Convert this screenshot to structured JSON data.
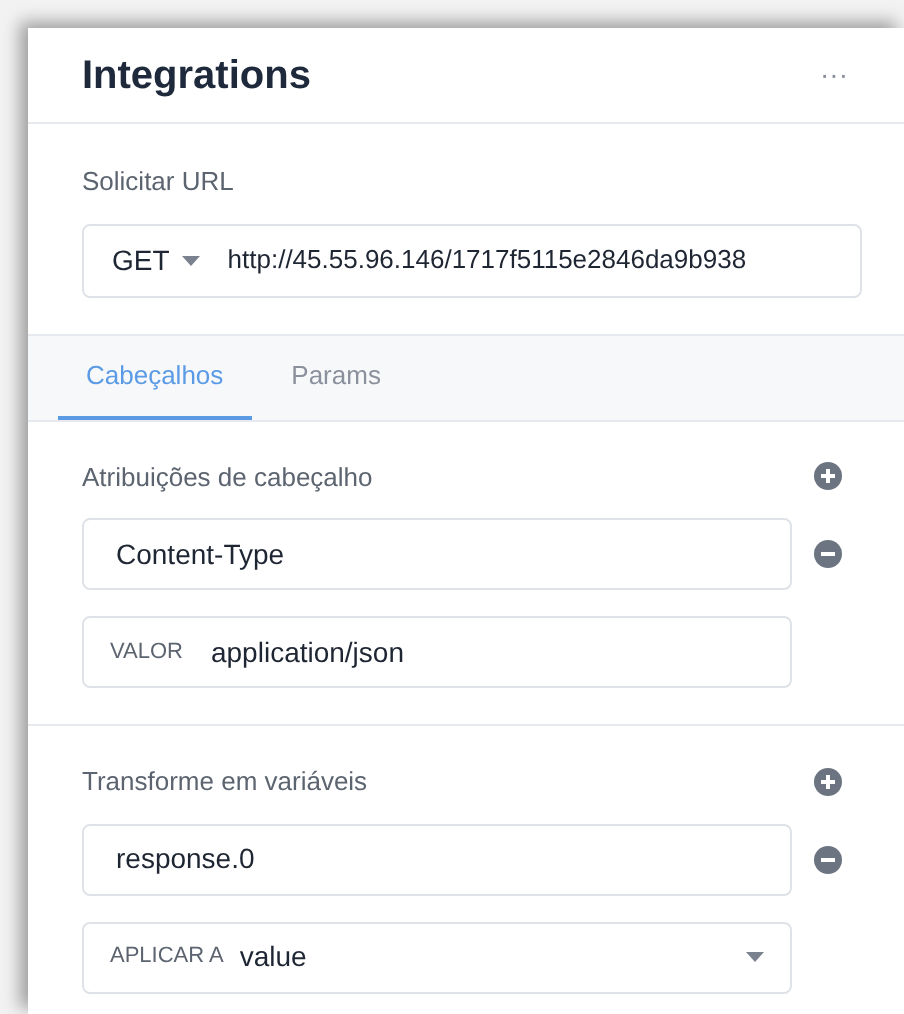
{
  "header": {
    "title": "Integrations",
    "menu": "···"
  },
  "request": {
    "label": "Solicitar URL",
    "method": "GET",
    "url": "http://45.55.96.146/1717f5115e2846da9b938"
  },
  "tabs": [
    {
      "label": "Cabeçalhos",
      "selected": true
    },
    {
      "label": "Params",
      "selected": false
    }
  ],
  "sections": [
    {
      "title": "Atribuições de cabeçalho",
      "key": "Content-Type",
      "kind": "field",
      "value_prefix": "VALOR",
      "value": "application/json"
    },
    {
      "title": "Transforme em variáveis",
      "key": "response.0",
      "kind": "select",
      "value_prefix": "APLICAR A",
      "value": "value"
    }
  ]
}
